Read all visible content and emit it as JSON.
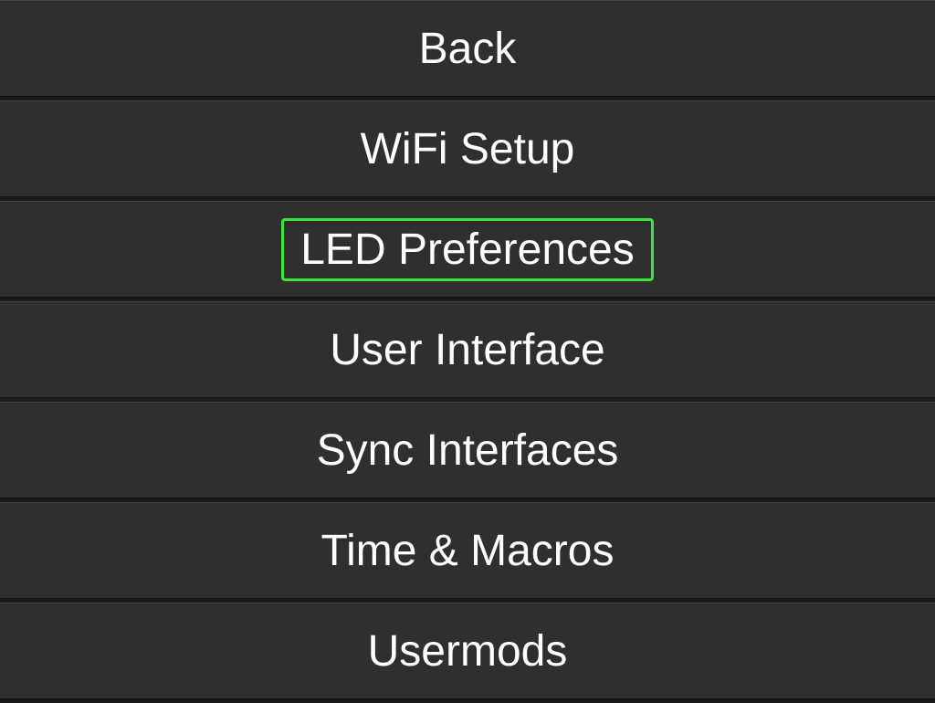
{
  "menu": {
    "items": [
      {
        "label": "Back",
        "highlighted": false
      },
      {
        "label": "WiFi Setup",
        "highlighted": false
      },
      {
        "label": "LED Preferences",
        "highlighted": true
      },
      {
        "label": "User Interface",
        "highlighted": false
      },
      {
        "label": "Sync Interfaces",
        "highlighted": false
      },
      {
        "label": "Time & Macros",
        "highlighted": false
      },
      {
        "label": "Usermods",
        "highlighted": false
      }
    ]
  },
  "colors": {
    "highlight": "#3be63b",
    "background": "#1a1a1a",
    "itemBackground": "#2f2f2f",
    "text": "#ffffff"
  }
}
